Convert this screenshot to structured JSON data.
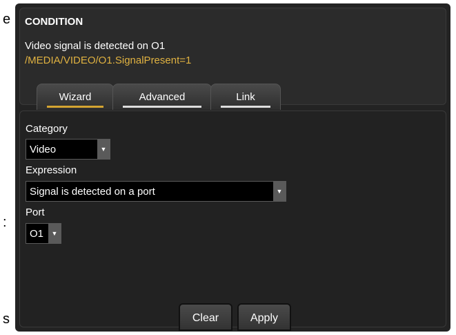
{
  "edge": {
    "char_top": "e",
    "char_middle": ":",
    "char_bottom": "s"
  },
  "condition": {
    "title": "CONDITION",
    "description": "Video signal is detected on O1",
    "expression": "/MEDIA/VIDEO/O1.SignalPresent=1",
    "expression_color": "#e0b241"
  },
  "tabs": [
    {
      "label": "Wizard",
      "active": true
    },
    {
      "label": "Advanced",
      "active": false
    },
    {
      "label": "Link",
      "active": false
    }
  ],
  "wizard": {
    "category_label": "Category",
    "category_value": "Video",
    "expression_label": "Expression",
    "expression_value": "Signal is detected on a port",
    "port_label": "Port",
    "port_value": "O1",
    "dropdown_icon": "chevron-down-icon"
  },
  "buttons": {
    "clear": "Clear",
    "apply": "Apply"
  },
  "colors": {
    "accent": "#d4a431",
    "panel_bg": "#232323"
  }
}
